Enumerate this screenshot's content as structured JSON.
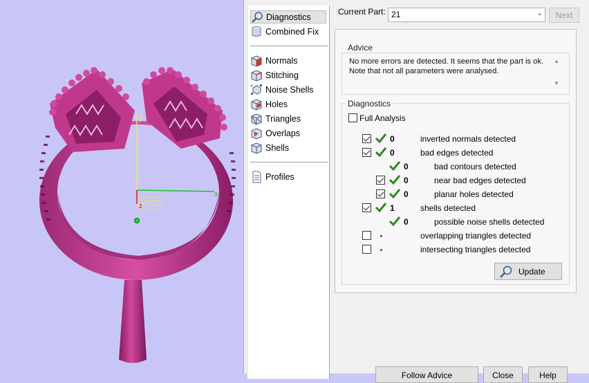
{
  "nav": {
    "items_top": [
      {
        "label": "Diagnostics",
        "icon": "magnifier-icon",
        "selected": true
      },
      {
        "label": "Combined Fix",
        "icon": "cylinder-icon",
        "selected": false
      }
    ],
    "items_mid": [
      {
        "label": "Normals",
        "icon": "normals-icon"
      },
      {
        "label": "Stitching",
        "icon": "stitching-icon"
      },
      {
        "label": "Noise Shells",
        "icon": "noise-shells-icon"
      },
      {
        "label": "Holes",
        "icon": "holes-icon"
      },
      {
        "label": "Triangles",
        "icon": "triangles-icon"
      },
      {
        "label": "Overlaps",
        "icon": "overlaps-icon"
      },
      {
        "label": "Shells",
        "icon": "shells-icon"
      }
    ],
    "items_bottom": [
      {
        "label": "Profiles",
        "icon": "document-icon"
      }
    ]
  },
  "current_part": {
    "label": "Current Part:",
    "value": "21",
    "next_label": "Next"
  },
  "advice": {
    "title": "Advice",
    "line1": "No more errors are detected. It seems that the part is ok.",
    "line2": "Note that not all parameters were analysed."
  },
  "diagnostics": {
    "title": "Diagnostics",
    "full_analysis_label": "Full Analysis",
    "rows": [
      {
        "label": "inverted normals detected",
        "count": "0",
        "checkbox": true,
        "status": "ok"
      },
      {
        "label": "bad edges detected",
        "count": "0",
        "checkbox": true,
        "status": "ok"
      },
      {
        "label": "bad contours detected",
        "count": "0",
        "checkbox": false,
        "status": "ok"
      },
      {
        "label": "near bad edges detected",
        "count": "0",
        "checkbox": true,
        "status": "ok"
      },
      {
        "label": "planar holes detected",
        "count": "0",
        "checkbox": true,
        "status": "ok"
      },
      {
        "label": "shells detected",
        "count": "1",
        "checkbox": true,
        "status": "ok"
      },
      {
        "label": "possible noise shells detected",
        "count": "0",
        "checkbox": false,
        "status": "ok"
      },
      {
        "label": "overlapping triangles detected",
        "count": "",
        "checkbox": true,
        "status": "not-run"
      },
      {
        "label": "intersecting triangles detected",
        "count": "",
        "checkbox": true,
        "status": "not-run"
      }
    ],
    "update_label": "Update"
  },
  "viewport": {
    "wcs_label": "WCS",
    "axis_y": "y",
    "axis_x": "x",
    "axis_z": "z",
    "colors": {
      "background": "#c8c6f6",
      "model": "#c0388c",
      "model_dark": "#7a1656",
      "axis_y": "#e8e27a",
      "axis_x": "#19c819",
      "axis_z": "#cc2222"
    }
  },
  "bottom_buttons": {
    "follow_advice": "Follow Advice",
    "close": "Close",
    "help": "Help"
  },
  "colors": {
    "check_green": "#2f8a1f",
    "info_blue": "#1f4fbf"
  }
}
